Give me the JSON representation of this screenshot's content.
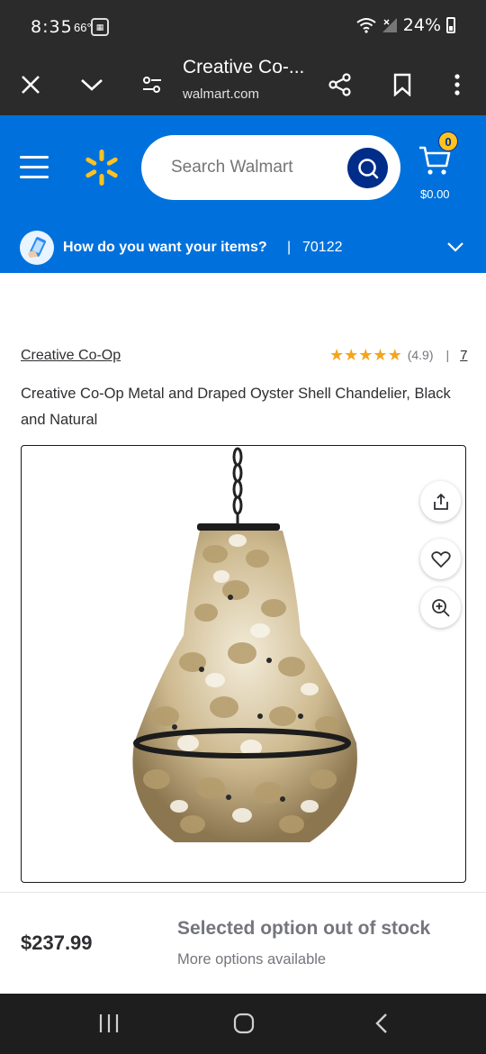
{
  "status_bar": {
    "time": "8:35",
    "temperature": "66°",
    "battery_percent": "24%"
  },
  "browser": {
    "title": "Creative Co-...",
    "url": "walmart.com",
    "icons": [
      "close-icon",
      "chevron-down-icon",
      "site-settings-icon",
      "share-icon",
      "bookmark-icon",
      "more-vert-icon"
    ]
  },
  "header": {
    "search_placeholder": "Search Walmart",
    "cart_count": "0",
    "cart_total": "$0.00",
    "brand_color": "#0071dc",
    "spark_color": "#ffc220"
  },
  "delivery": {
    "prompt": "How do you want your items?",
    "separator": "|",
    "zip": "70122"
  },
  "product": {
    "brand": "Creative Co-Op",
    "rating_stars": 4.9,
    "rating_value": "(4.9)",
    "rating_separator": "|",
    "rating_count": "7",
    "title": "Creative Co-Op Metal and Draped Oyster Shell Chandelier, Black and Natural",
    "image_actions": [
      "share-icon",
      "heart-icon",
      "zoom-in-icon"
    ]
  },
  "purchase_bar": {
    "price": "$237.99",
    "stock_status": "Selected option out of stock",
    "stock_note": "More options available"
  },
  "nav_bar": {
    "icons": [
      "recent-apps-icon",
      "home-icon",
      "back-icon"
    ]
  }
}
